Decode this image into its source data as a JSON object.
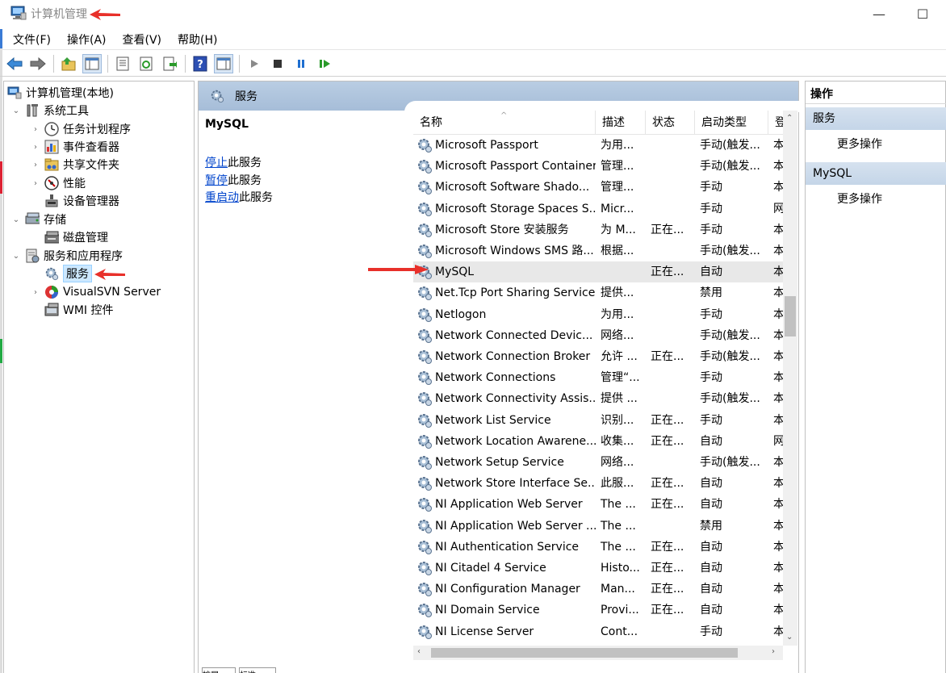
{
  "window": {
    "title": "计算机管理",
    "minimize": "—",
    "maximize": "☐"
  },
  "menu": [
    "文件(F)",
    "操作(A)",
    "查看(V)",
    "帮助(H)"
  ],
  "toolbar": {
    "buttons": [
      "back-arrow-icon",
      "forward-arrow-icon",
      "up-folder-icon",
      "show-tree-icon",
      "properties-icon",
      "refresh-icon",
      "export-icon",
      "help-icon",
      "panel-icon",
      "play-icon",
      "stop-icon",
      "pause-icon",
      "restart-icon"
    ]
  },
  "tree": {
    "root": "计算机管理(本地)",
    "system_tools": "系统工具",
    "task_scheduler": "任务计划程序",
    "event_viewer": "事件查看器",
    "shared_folders": "共享文件夹",
    "performance": "性能",
    "device_manager": "设备管理器",
    "storage": "存储",
    "disk_management": "磁盘管理",
    "services_apps": "服务和应用程序",
    "services": "服务",
    "visualsvn": "VisualSVN Server",
    "wmi": "WMI 控件"
  },
  "middle": {
    "header": "服务",
    "selected_service": "MySQL",
    "links": [
      {
        "link": "停止",
        "rest": "此服务"
      },
      {
        "link": "暂停",
        "rest": "此服务"
      },
      {
        "link": "重启动",
        "rest": "此服务"
      }
    ],
    "columns": {
      "name": "名称",
      "desc": "描述",
      "status": "状态",
      "startup": "启动类型",
      "logon": "登"
    },
    "sort_caret": "^",
    "rows": [
      {
        "name": "Microsoft Passport",
        "desc": "为用...",
        "status": "",
        "startup": "手动(触发...",
        "logon": "本"
      },
      {
        "name": "Microsoft Passport Container",
        "desc": "管理...",
        "status": "",
        "startup": "手动(触发...",
        "logon": "本"
      },
      {
        "name": "Microsoft Software Shado...",
        "desc": "管理...",
        "status": "",
        "startup": "手动",
        "logon": "本"
      },
      {
        "name": "Microsoft Storage Spaces S...",
        "desc": "Micr...",
        "status": "",
        "startup": "手动",
        "logon": "网"
      },
      {
        "name": "Microsoft Store 安装服务",
        "desc": "为 M...",
        "status": "正在...",
        "startup": "手动",
        "logon": "本"
      },
      {
        "name": "Microsoft Windows SMS 路...",
        "desc": "根据...",
        "status": "",
        "startup": "手动(触发...",
        "logon": "本"
      },
      {
        "name": "MySQL",
        "desc": "",
        "status": "正在...",
        "startup": "自动",
        "logon": "本"
      },
      {
        "name": "Net.Tcp Port Sharing Service",
        "desc": "提供...",
        "status": "",
        "startup": "禁用",
        "logon": "本"
      },
      {
        "name": "Netlogon",
        "desc": "为用...",
        "status": "",
        "startup": "手动",
        "logon": "本"
      },
      {
        "name": "Network Connected Devic...",
        "desc": "网络...",
        "status": "",
        "startup": "手动(触发...",
        "logon": "本"
      },
      {
        "name": "Network Connection Broker",
        "desc": "允许 ...",
        "status": "正在...",
        "startup": "手动(触发...",
        "logon": "本"
      },
      {
        "name": "Network Connections",
        "desc": "管理“...",
        "status": "",
        "startup": "手动",
        "logon": "本"
      },
      {
        "name": "Network Connectivity Assis...",
        "desc": "提供 ...",
        "status": "",
        "startup": "手动(触发...",
        "logon": "本"
      },
      {
        "name": "Network List Service",
        "desc": "识别...",
        "status": "正在...",
        "startup": "手动",
        "logon": "本"
      },
      {
        "name": "Network Location Awarene...",
        "desc": "收集...",
        "status": "正在...",
        "startup": "自动",
        "logon": "网"
      },
      {
        "name": "Network Setup Service",
        "desc": "网络...",
        "status": "",
        "startup": "手动(触发...",
        "logon": "本"
      },
      {
        "name": "Network Store Interface Se...",
        "desc": "此服...",
        "status": "正在...",
        "startup": "自动",
        "logon": "本"
      },
      {
        "name": "NI Application Web Server",
        "desc": "The ...",
        "status": "正在...",
        "startup": "自动",
        "logon": "本"
      },
      {
        "name": "NI Application Web Server ...",
        "desc": "The ...",
        "status": "",
        "startup": "禁用",
        "logon": "本"
      },
      {
        "name": "NI Authentication Service",
        "desc": "The ...",
        "status": "正在...",
        "startup": "自动",
        "logon": "本"
      },
      {
        "name": "NI Citadel 4 Service",
        "desc": "Histo...",
        "status": "正在...",
        "startup": "自动",
        "logon": "本"
      },
      {
        "name": "NI Configuration Manager",
        "desc": "Man...",
        "status": "正在...",
        "startup": "自动",
        "logon": "本"
      },
      {
        "name": "NI Domain Service",
        "desc": "Provi...",
        "status": "正在...",
        "startup": "自动",
        "logon": "本"
      },
      {
        "name": "NI License Server",
        "desc": "Cont...",
        "status": "",
        "startup": "手动",
        "logon": "本"
      }
    ],
    "selected_index": 6,
    "bottom_tabs": [
      "扩展",
      "标准"
    ]
  },
  "actions": {
    "title": "操作",
    "groups": [
      {
        "label": "服务",
        "item": "更多操作"
      },
      {
        "label": "MySQL",
        "item": "更多操作"
      }
    ]
  },
  "colors": {
    "header_blue": "#a6bdd8",
    "selection": "#cce8ff",
    "link": "#0044cc",
    "annotation_red": "#e8302a"
  }
}
